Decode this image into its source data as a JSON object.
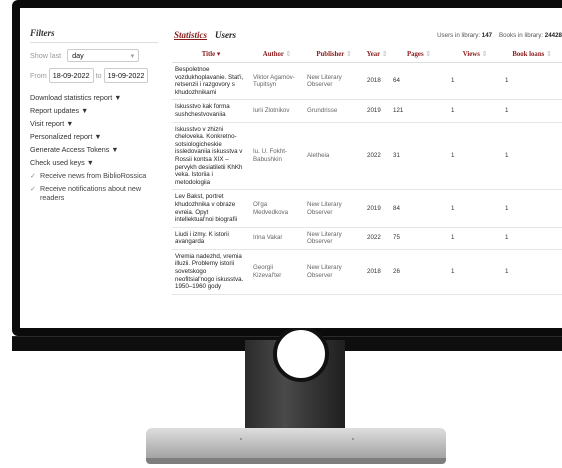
{
  "sidebar": {
    "title": "Filters",
    "show_last_label": "Show last",
    "show_last_value": "day",
    "from_label": "From",
    "from_date": "18-09-2022",
    "to_label": "to",
    "to_date": "19-09-2022",
    "links": [
      "Download statistics report ▼",
      "Report updates ▼",
      "Visit report ▼",
      "Personalized report ▼",
      "Generate Access Tokens ▼",
      "Check used keys ▼"
    ],
    "checks": [
      "Receive news from BiblioRossica",
      "Receive notifications about new readers"
    ]
  },
  "tabs": {
    "statistics": "Statistics",
    "users": "Users"
  },
  "counts": {
    "users_label": "Users in library:",
    "users_value": "147",
    "books_label": "Books in library:",
    "books_value": "24428"
  },
  "table": {
    "headers": [
      "Title",
      "Author",
      "Publisher",
      "Year",
      "Pages",
      "Views",
      "Book loans"
    ],
    "rows": [
      [
        "Bespoletnoe vozdukhoplavanie. Stat'i, retsenzii i razgovory s khudozhnikami",
        "Viktor Agamov-Tupitsyn",
        "New Literary Observer",
        "2018",
        "64",
        "1",
        "1"
      ],
      [
        "Iskusstvo kak forma sushchestvovaniia",
        "Iurii Zlotnikov",
        "Grundrisse",
        "2019",
        "121",
        "1",
        "1"
      ],
      [
        "Iskusstvo v zhizni cheloveka. Konkretno-sotsiologicheskie issledovaniia iskusstva v Rossii kontsa XIX – pervykh desiatiletii KhKh veka. Istoriia i metodologiia",
        "Iu. U. Fokht-Babushkin",
        "Aletheia",
        "2022",
        "31",
        "1",
        "1"
      ],
      [
        "Lev Bakst, portret khudozhnika v obraze evreia. Opyt intellektual'noi biografii",
        "Ol'ga Medvedkova",
        "New Literary Observer",
        "2019",
        "84",
        "1",
        "1"
      ],
      [
        "Liudi i izmy. K istorii avangarda",
        "Irina Vakar",
        "New Literary Observer",
        "2022",
        "75",
        "1",
        "1"
      ],
      [
        "Vremia nadezhd, vremia illuzii. Problemy istorii sovetskogo neofitsial'nogo iskusstva. 1950–1960 gody",
        "Georgii Kizeval'ter",
        "New Literary Observer",
        "2018",
        "26",
        "1",
        "1"
      ]
    ]
  }
}
